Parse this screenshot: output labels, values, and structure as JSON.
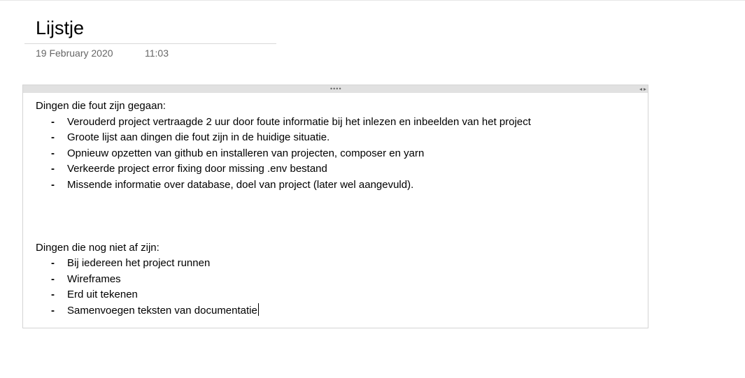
{
  "page": {
    "title": "Lijstje",
    "date": "19 February 2020",
    "time": "11:03"
  },
  "sections": [
    {
      "heading": "Dingen die fout zijn gegaan:",
      "items": [
        "Verouderd project vertraagde 2 uur door foute informatie bij het inlezen en inbeelden van het project",
        "Groote lijst aan dingen die fout zijn in de huidige situatie.",
        "Opnieuw opzetten van github en installeren van projecten, composer en yarn",
        "Verkeerde project error fixing door missing .env bestand",
        "Missende informatie over database, doel van project (later wel aangevuld)."
      ]
    },
    {
      "heading": "Dingen die nog niet af zijn:",
      "items": [
        "Bij iedereen het project runnen",
        "Wireframes",
        "Erd uit tekenen",
        "Samenvoegen teksten van documentatie"
      ]
    }
  ],
  "bullet_glyph": "-",
  "icons": {
    "grip": "drag-handle-icon",
    "arrows": "resize-arrows-icon"
  }
}
